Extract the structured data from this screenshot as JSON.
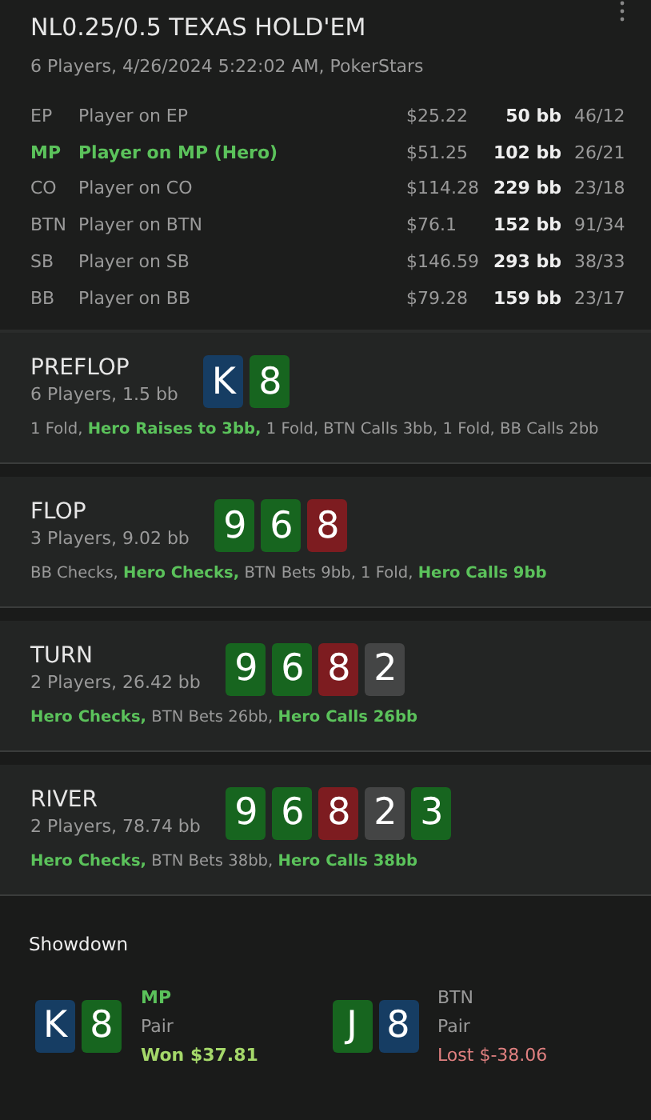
{
  "header": {
    "title": "NL0.25/0.5 TEXAS HOLD'EM",
    "subtitle": "6 Players, 4/26/2024 5:22:02 AM, PokerStars"
  },
  "players": [
    {
      "position": "EP",
      "name": "Player on EP",
      "stack": "$25.22",
      "bb": "50 bb",
      "stats": "46/12",
      "hero": false
    },
    {
      "position": "MP",
      "name": "Player on MP (Hero)",
      "stack": "$51.25",
      "bb": "102 bb",
      "stats": "26/21",
      "hero": true
    },
    {
      "position": "CO",
      "name": "Player on CO",
      "stack": "$114.28",
      "bb": "229 bb",
      "stats": "23/18",
      "hero": false
    },
    {
      "position": "BTN",
      "name": "Player on BTN",
      "stack": "$76.1",
      "bb": "152 bb",
      "stats": "91/34",
      "hero": false
    },
    {
      "position": "SB",
      "name": "Player on SB",
      "stack": "$146.59",
      "bb": "293 bb",
      "stats": "38/33",
      "hero": false
    },
    {
      "position": "BB",
      "name": "Player on BB",
      "stack": "$79.28",
      "bb": "159 bb",
      "stats": "23/17",
      "hero": false
    }
  ],
  "streets": [
    {
      "name": "PREFLOP",
      "info": "6 Players, 1.5 bb",
      "cards": [
        {
          "rank": "K",
          "color": "#163d63"
        },
        {
          "rank": "8",
          "color": "#17651f"
        }
      ],
      "actions": [
        {
          "text": "1 Fold,",
          "hero": false
        },
        {
          "text": "Hero Raises to 3bb,",
          "hero": true
        },
        {
          "text": "1 Fold, BTN Calls 3bb, 1 Fold, BB Calls 2bb",
          "hero": false
        }
      ]
    },
    {
      "name": "FLOP",
      "info": "3 Players, 9.02 bb",
      "cards": [
        {
          "rank": "9",
          "color": "#17651f"
        },
        {
          "rank": "6",
          "color": "#17651f"
        },
        {
          "rank": "8",
          "color": "#7d1c20"
        }
      ],
      "actions": [
        {
          "text": "BB Checks,",
          "hero": false
        },
        {
          "text": "Hero Checks,",
          "hero": true
        },
        {
          "text": "BTN Bets 9bb, 1 Fold,",
          "hero": false
        },
        {
          "text": "Hero Calls 9bb",
          "hero": true
        }
      ]
    },
    {
      "name": "TURN",
      "info": "2 Players, 26.42 bb",
      "cards": [
        {
          "rank": "9",
          "color": "#17651f"
        },
        {
          "rank": "6",
          "color": "#17651f"
        },
        {
          "rank": "8",
          "color": "#7d1c20"
        },
        {
          "rank": "2",
          "color": "#444545"
        }
      ],
      "actions": [
        {
          "text": "Hero Checks,",
          "hero": true
        },
        {
          "text": "BTN Bets 26bb,",
          "hero": false
        },
        {
          "text": "Hero Calls 26bb",
          "hero": true
        }
      ]
    },
    {
      "name": "RIVER",
      "info": "2 Players, 78.74 bb",
      "cards": [
        {
          "rank": "9",
          "color": "#17651f"
        },
        {
          "rank": "6",
          "color": "#17651f"
        },
        {
          "rank": "8",
          "color": "#7d1c20"
        },
        {
          "rank": "2",
          "color": "#444545"
        },
        {
          "rank": "3",
          "color": "#17651f"
        }
      ],
      "actions": [
        {
          "text": "Hero Checks,",
          "hero": true
        },
        {
          "text": "BTN Bets 38bb,",
          "hero": false
        },
        {
          "text": "Hero Calls 38bb",
          "hero": true
        }
      ]
    }
  ],
  "showdown": {
    "title": "Showdown",
    "hands": [
      {
        "cards": [
          {
            "rank": "K",
            "color": "#163d63"
          },
          {
            "rank": "8",
            "color": "#17651f"
          }
        ],
        "position": "MP",
        "hero": true,
        "hand": "Pair",
        "result": "Won $37.81",
        "kind": "win"
      },
      {
        "cards": [
          {
            "rank": "J",
            "color": "#17651f"
          },
          {
            "rank": "8",
            "color": "#163d63"
          }
        ],
        "position": "BTN",
        "hero": false,
        "hand": "Pair",
        "result": "Lost $-38.06",
        "kind": "loss"
      }
    ]
  }
}
